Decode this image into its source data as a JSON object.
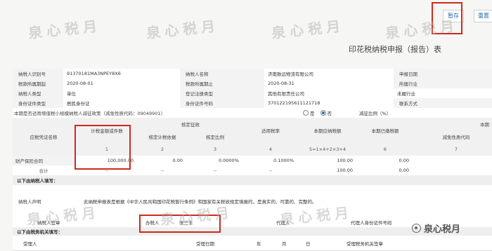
{
  "toolbar": {
    "save_label": "暂存",
    "reset_label": "重置"
  },
  "watermark": {
    "text": "泉心税月"
  },
  "form_title": "印花税纳税申报（报告）表",
  "header": {
    "r1": {
      "taxpayer_id_label": "纳税人识别号",
      "taxpayer_id_value": "91370181MA3NPEY8X6",
      "taxpayer_name_label": "纳税人名称",
      "taxpayer_name_value": "济南致远物流有限公司",
      "report_date_label": "申报日期"
    },
    "r2": {
      "period_start_label": "税款所属期起",
      "period_start_value": "2020-08-01",
      "period_end_label": "税款所属期止",
      "period_end_value": "2020-08-31",
      "industry_label": "所属行业"
    },
    "r3": {
      "taxpayer_type_label": "纳税人类型",
      "taxpayer_type_value": "单位",
      "reg_type_label": "登记注册类型",
      "reg_type_value": "其他有限责任公司",
      "industry_value": "未履行业"
    },
    "r4": {
      "id_type_label": "身份证件类型",
      "id_type_value": "居民身份证",
      "id_no_label": "身份证件号码",
      "id_no_value": "370122195611121718",
      "contact_label": "联系方式"
    },
    "r5": {
      "small_scale_label": "本期是否适用增值税小规模纳税人减征政策（减免性质代码：09049901）",
      "yes_label": "是",
      "no_label": "否",
      "reduction_ratio_label": "减征比例（%）"
    }
  },
  "table_head": {
    "voucher_name": "应税凭证名称",
    "taxable_amount": "计税金额或件数",
    "assessed": "核定征收",
    "assessed_basis": "核定计税依据",
    "assessed_ratio": "核定比例",
    "tax_rate": "适用税率",
    "tax_payable": "本期应纳税额",
    "tax_paid": "本期已缴税额",
    "current_col": "本期",
    "exempt_code": "减免性质代码",
    "col_nums": [
      "1",
      "2",
      "3",
      "4",
      "5=1×4+2×3×4",
      "6",
      "7"
    ]
  },
  "table_rows": [
    {
      "name": "财产保险合同",
      "amount": "100,000.00",
      "basis": "0.00",
      "ratio": "0.0000%",
      "rate": "0.1000%",
      "payable": "100.00",
      "paid": "0.00"
    },
    {
      "name": "合计",
      "amount": "--",
      "basis": "--",
      "ratio": "--",
      "rate": "--",
      "payable": "100.00",
      "paid": "0.00"
    }
  ],
  "taxpayer_section": {
    "title": "以下由纳税人填写：",
    "declaration_label": "纳税人声明",
    "declaration_text": "此纳税申报表是根据《中华人民共和国印花税暂行条例》和国家有关税收规定填报的，是真实的、可靠的、完整的。",
    "signature_label": "纳税人签章",
    "handler_label": "办税人",
    "handler_value": "张三丰",
    "agent_label": "代理人",
    "agent_id_label": "代理人身份证件号码"
  },
  "tax_office_section": {
    "title": "以下由税务机关填写：",
    "receiver_label": "受理人",
    "receive_date_label": "受理日期",
    "year_label": "年",
    "month_label": "月",
    "day_label": "日",
    "office_seal_label": "受理税务机关签章"
  },
  "brand": {
    "name": "泉心税月"
  },
  "colors": {
    "highlight": "#d0281f",
    "link_blue": "#2a6db3"
  }
}
